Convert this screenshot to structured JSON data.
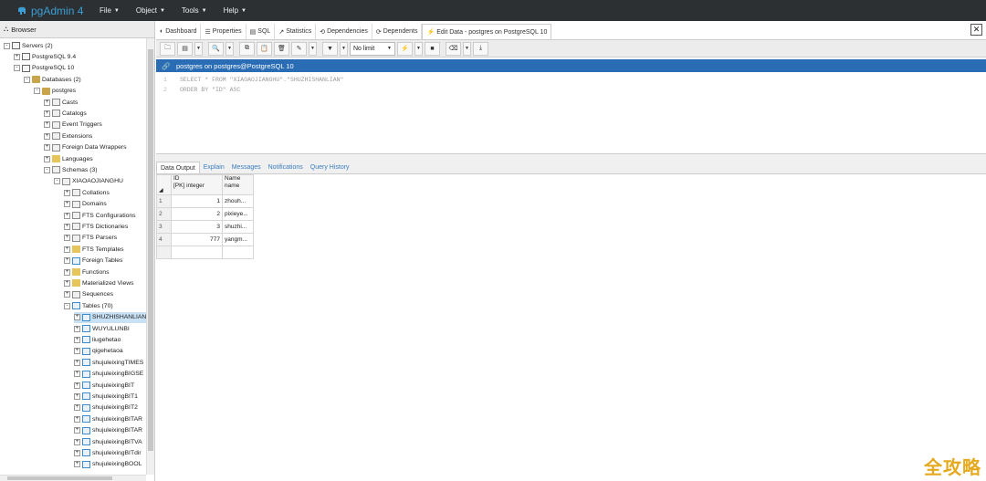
{
  "app": {
    "title": "pgAdmin 4"
  },
  "menu": [
    {
      "label": "File"
    },
    {
      "label": "Object"
    },
    {
      "label": "Tools"
    },
    {
      "label": "Help"
    }
  ],
  "browser": {
    "title": "Browser",
    "tree": [
      {
        "label": "Servers (2)",
        "depth": 0,
        "toggle": "-",
        "icon": "srv"
      },
      {
        "label": "PostgreSQL 9.4",
        "depth": 1,
        "toggle": "+",
        "icon": "srv"
      },
      {
        "label": "PostgreSQL 10",
        "depth": 1,
        "toggle": "-",
        "icon": "srv"
      },
      {
        "label": "Databases (2)",
        "depth": 2,
        "toggle": "-",
        "icon": "db"
      },
      {
        "label": "postgres",
        "depth": 3,
        "toggle": "-",
        "icon": "db"
      },
      {
        "label": "Casts",
        "depth": 4,
        "toggle": "+",
        "icon": "gen"
      },
      {
        "label": "Catalogs",
        "depth": 4,
        "toggle": "+",
        "icon": "gen"
      },
      {
        "label": "Event Triggers",
        "depth": 4,
        "toggle": "+",
        "icon": "gen"
      },
      {
        "label": "Extensions",
        "depth": 4,
        "toggle": "+",
        "icon": "gen"
      },
      {
        "label": "Foreign Data Wrappers",
        "depth": 4,
        "toggle": "+",
        "icon": "gen"
      },
      {
        "label": "Languages",
        "depth": 4,
        "toggle": "+",
        "icon": "fld"
      },
      {
        "label": "Schemas (3)",
        "depth": 4,
        "toggle": "-",
        "icon": "gen"
      },
      {
        "label": "XIAOAOJIANGHU",
        "depth": 5,
        "toggle": "-",
        "icon": "gen"
      },
      {
        "label": "Collations",
        "depth": 6,
        "toggle": "+",
        "icon": "gen"
      },
      {
        "label": "Domains",
        "depth": 6,
        "toggle": "+",
        "icon": "gen"
      },
      {
        "label": "FTS Configurations",
        "depth": 6,
        "toggle": "+",
        "icon": "gen"
      },
      {
        "label": "FTS Dictionaries",
        "depth": 6,
        "toggle": "+",
        "icon": "gen"
      },
      {
        "label": "FTS Parsers",
        "depth": 6,
        "toggle": "+",
        "icon": "gen"
      },
      {
        "label": "FTS Templates",
        "depth": 6,
        "toggle": "+",
        "icon": "fld"
      },
      {
        "label": "Foreign Tables",
        "depth": 6,
        "toggle": "+",
        "icon": "tbl"
      },
      {
        "label": "Functions",
        "depth": 6,
        "toggle": "+",
        "icon": "fld"
      },
      {
        "label": "Materialized Views",
        "depth": 6,
        "toggle": "+",
        "icon": "fld"
      },
      {
        "label": "Sequences",
        "depth": 6,
        "toggle": "+",
        "icon": "gen"
      },
      {
        "label": "Tables (70)",
        "depth": 6,
        "toggle": "-",
        "icon": "tbl"
      },
      {
        "label": "SHUZHISHANLIAN",
        "depth": 7,
        "toggle": "+",
        "icon": "tbl",
        "selected": true
      },
      {
        "label": "WUYULUNBI",
        "depth": 7,
        "toggle": "+",
        "icon": "tbl"
      },
      {
        "label": "liugehetao",
        "depth": 7,
        "toggle": "+",
        "icon": "tbl"
      },
      {
        "label": "qigehetaoa",
        "depth": 7,
        "toggle": "+",
        "icon": "tbl"
      },
      {
        "label": "shujuleixingTIMES",
        "depth": 7,
        "toggle": "+",
        "icon": "tbl"
      },
      {
        "label": "shujuleixingBIGSE",
        "depth": 7,
        "toggle": "+",
        "icon": "tbl"
      },
      {
        "label": "shujuleixingBIT",
        "depth": 7,
        "toggle": "+",
        "icon": "tbl"
      },
      {
        "label": "shujuleixingBIT1",
        "depth": 7,
        "toggle": "+",
        "icon": "tbl"
      },
      {
        "label": "shujuleixingBIT2",
        "depth": 7,
        "toggle": "+",
        "icon": "tbl"
      },
      {
        "label": "shujuleixingBITAR",
        "depth": 7,
        "toggle": "+",
        "icon": "tbl"
      },
      {
        "label": "shujuleixingBITAR",
        "depth": 7,
        "toggle": "+",
        "icon": "tbl"
      },
      {
        "label": "shujuleixingBITVA",
        "depth": 7,
        "toggle": "+",
        "icon": "tbl"
      },
      {
        "label": "shujuleixingBITdir",
        "depth": 7,
        "toggle": "+",
        "icon": "tbl"
      },
      {
        "label": "shujuleixingBOOL",
        "depth": 7,
        "toggle": "+",
        "icon": "tbl"
      }
    ]
  },
  "tabs": [
    {
      "label": "Dashboard",
      "icon": "dashboard-icon"
    },
    {
      "label": "Properties",
      "icon": "properties-icon"
    },
    {
      "label": "SQL",
      "icon": "sql-icon"
    },
    {
      "label": "Statistics",
      "icon": "statistics-icon"
    },
    {
      "label": "Dependencies",
      "icon": "dependencies-icon"
    },
    {
      "label": "Dependents",
      "icon": "dependents-icon"
    },
    {
      "label": "Edit Data - postgres on PostgreSQL 10",
      "icon": "edit-data-icon",
      "active": true
    }
  ],
  "toolbar": {
    "limit_value": "No limit"
  },
  "query": {
    "connection": "postgres on postgres@PostgreSQL 10",
    "lines": [
      {
        "no": "1",
        "text": "SELECT * FROM \"XIAOAOJIANGHU\".\"SHUZHISHANLIAN\""
      },
      {
        "no": "2",
        "text": "ORDER BY \"ID\" ASC"
      }
    ]
  },
  "result_tabs": [
    {
      "label": "Data Output",
      "active": true
    },
    {
      "label": "Explain"
    },
    {
      "label": "Messages"
    },
    {
      "label": "Notifications"
    },
    {
      "label": "Query History"
    }
  ],
  "grid": {
    "columns": [
      {
        "name": "ID",
        "type": "[PK] integer"
      },
      {
        "name": "Name",
        "type": "name"
      }
    ],
    "rows": [
      {
        "n": "1",
        "id": "1",
        "name": "zhouh..."
      },
      {
        "n": "2",
        "id": "2",
        "name": "pixieye..."
      },
      {
        "n": "3",
        "id": "3",
        "name": "shuzhi..."
      },
      {
        "n": "4",
        "id": "777",
        "name": "yangm..."
      }
    ]
  },
  "watermark": "全攻略",
  "colors": {
    "navbar": "#2c3033",
    "brand": "#3a9ed4",
    "header": "#2a6db5",
    "watermark": "#e5a91e"
  }
}
